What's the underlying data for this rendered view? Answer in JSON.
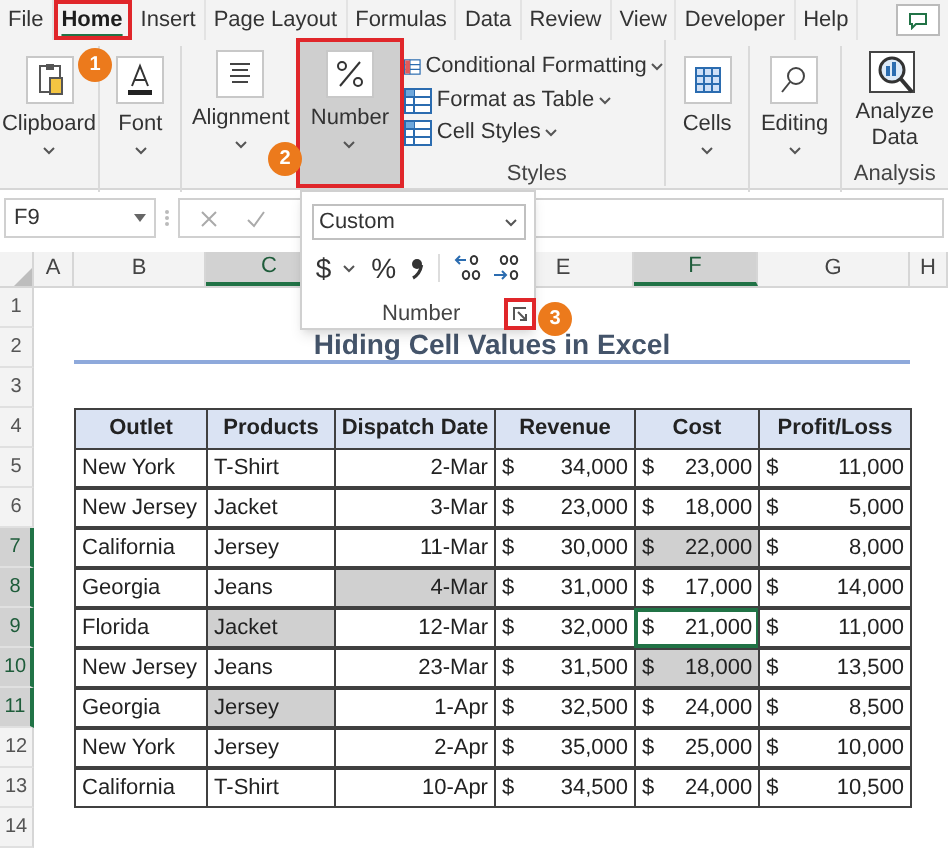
{
  "tabs": [
    {
      "label": "File",
      "selected": false
    },
    {
      "label": "Home",
      "selected": true
    },
    {
      "label": "Insert",
      "selected": false
    },
    {
      "label": "Page Layout",
      "selected": false
    },
    {
      "label": "Formulas",
      "selected": false
    },
    {
      "label": "Data",
      "selected": false
    },
    {
      "label": "Review",
      "selected": false
    },
    {
      "label": "View",
      "selected": false
    },
    {
      "label": "Developer",
      "selected": false
    },
    {
      "label": "Help",
      "selected": false
    }
  ],
  "groups": [
    {
      "kind": "button",
      "label": "Clipboard",
      "selected": false
    },
    {
      "kind": "button",
      "label": "Font",
      "selected": false
    },
    {
      "kind": "button",
      "label": "Alignment",
      "selected": false
    },
    {
      "kind": "button",
      "label": "Number",
      "selected": true
    },
    {
      "kind": "list",
      "items": [
        "Conditional Formatting",
        "Format as Table",
        "Cell Styles"
      ],
      "caption": "Styles"
    },
    {
      "kind": "button",
      "label": "Cells",
      "selected": false
    },
    {
      "kind": "button",
      "label": "Editing",
      "selected": false
    },
    {
      "kind": "big",
      "label": "Analyze Data",
      "caption": "Analysis"
    }
  ],
  "callouts": [
    "1",
    "2",
    "3"
  ],
  "number_dropdown": {
    "format": "Custom",
    "currency": "$",
    "percent": "%",
    "caption": "Number"
  },
  "formula_bar": {
    "name_box": "F9"
  },
  "column_headers": [
    {
      "label": "A",
      "selected": false
    },
    {
      "label": "B",
      "selected": false
    },
    {
      "label": "C",
      "selected": true
    },
    {
      "label": "E",
      "selected": false
    },
    {
      "label": "F",
      "selected": true
    },
    {
      "label": "G",
      "selected": false
    },
    {
      "label": "H",
      "selected": false
    }
  ],
  "row_headers": [
    {
      "label": "1",
      "selected": false
    },
    {
      "label": "2",
      "selected": false
    },
    {
      "label": "3",
      "selected": false
    },
    {
      "label": "4",
      "selected": false
    },
    {
      "label": "5",
      "selected": false
    },
    {
      "label": "6",
      "selected": false
    },
    {
      "label": "7",
      "selected": true
    },
    {
      "label": "8",
      "selected": true
    },
    {
      "label": "9",
      "selected": true
    },
    {
      "label": "10",
      "selected": true
    },
    {
      "label": "11",
      "selected": true
    },
    {
      "label": "12",
      "selected": false
    },
    {
      "label": "13",
      "selected": false
    },
    {
      "label": "14",
      "selected": false
    }
  ],
  "title": "Hiding Cell Values in Excel",
  "table": {
    "columns": [
      {
        "label": "Outlet",
        "kind": "text"
      },
      {
        "label": "Products",
        "kind": "text"
      },
      {
        "label": "Dispatch Date",
        "kind": "date"
      },
      {
        "label": "Revenue",
        "kind": "currency"
      },
      {
        "label": "Cost",
        "kind": "currency"
      },
      {
        "label": "Profit/Loss",
        "kind": "currency"
      }
    ],
    "rows": [
      {
        "cells": [
          "New York",
          "T-Shirt",
          "2-Mar",
          [
            "$",
            "34,000"
          ],
          [
            "$",
            "23,000"
          ],
          [
            "$",
            "11,000"
          ]
        ],
        "selected": [
          false,
          false,
          false,
          false,
          false,
          false
        ],
        "active": [
          false,
          false,
          false,
          false,
          false,
          false
        ]
      },
      {
        "cells": [
          "New Jersey",
          "Jacket",
          "3-Mar",
          [
            "$",
            "23,000"
          ],
          [
            "$",
            "18,000"
          ],
          [
            "$",
            "5,000"
          ]
        ],
        "selected": [
          false,
          false,
          false,
          false,
          false,
          false
        ],
        "active": [
          false,
          false,
          false,
          false,
          false,
          false
        ]
      },
      {
        "cells": [
          "California",
          "Jersey",
          "11-Mar",
          [
            "$",
            "30,000"
          ],
          [
            "$",
            "22,000"
          ],
          [
            "$",
            "8,000"
          ]
        ],
        "selected": [
          false,
          false,
          false,
          false,
          true,
          false
        ],
        "active": [
          false,
          false,
          false,
          false,
          false,
          false
        ]
      },
      {
        "cells": [
          "Georgia",
          "Jeans",
          "4-Mar",
          [
            "$",
            "31,000"
          ],
          [
            "$",
            "17,000"
          ],
          [
            "$",
            "14,000"
          ]
        ],
        "selected": [
          false,
          false,
          true,
          false,
          false,
          false
        ],
        "active": [
          false,
          false,
          false,
          false,
          false,
          false
        ]
      },
      {
        "cells": [
          "Florida",
          "Jacket",
          "12-Mar",
          [
            "$",
            "32,000"
          ],
          [
            "$",
            "21,000"
          ],
          [
            "$",
            "11,000"
          ]
        ],
        "selected": [
          false,
          true,
          false,
          false,
          false,
          false
        ],
        "active": [
          false,
          false,
          false,
          false,
          true,
          false
        ]
      },
      {
        "cells": [
          "New Jersey",
          "Jeans",
          "23-Mar",
          [
            "$",
            "31,500"
          ],
          [
            "$",
            "18,000"
          ],
          [
            "$",
            "13,500"
          ]
        ],
        "selected": [
          false,
          false,
          false,
          false,
          true,
          false
        ],
        "active": [
          false,
          false,
          false,
          false,
          false,
          false
        ]
      },
      {
        "cells": [
          "Georgia",
          "Jersey",
          "1-Apr",
          [
            "$",
            "32,500"
          ],
          [
            "$",
            "24,000"
          ],
          [
            "$",
            "8,500"
          ]
        ],
        "selected": [
          false,
          true,
          false,
          false,
          false,
          false
        ],
        "active": [
          false,
          false,
          false,
          false,
          false,
          false
        ]
      },
      {
        "cells": [
          "New York",
          "Jersey",
          "2-Apr",
          [
            "$",
            "35,000"
          ],
          [
            "$",
            "25,000"
          ],
          [
            "$",
            "10,000"
          ]
        ],
        "selected": [
          false,
          false,
          false,
          false,
          false,
          false
        ],
        "active": [
          false,
          false,
          false,
          false,
          false,
          false
        ]
      },
      {
        "cells": [
          "California",
          "T-Shirt",
          "10-Apr",
          [
            "$",
            "34,500"
          ],
          [
            "$",
            "24,000"
          ],
          [
            "$",
            "10,500"
          ]
        ],
        "selected": [
          false,
          false,
          false,
          false,
          false,
          false
        ],
        "active": [
          false,
          false,
          false,
          false,
          false,
          false
        ]
      }
    ]
  }
}
